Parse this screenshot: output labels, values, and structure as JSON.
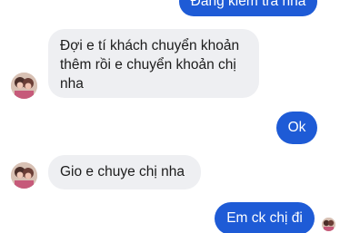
{
  "messages": [
    {
      "sender": "me",
      "text": "Đang kiểm tra nha"
    },
    {
      "sender": "contact",
      "lines": [
        "Đợi e tí khách chuyển khoản",
        "thêm rồi e chuyển khoản chị",
        "nha"
      ]
    },
    {
      "sender": "me",
      "text": "Ok"
    },
    {
      "sender": "contact",
      "text": "Gio e chuye chị nha"
    },
    {
      "sender": "me",
      "text": "Em ck chị đi"
    }
  ],
  "colors": {
    "outgoing_bubble": "#1e5bd6",
    "incoming_bubble": "#eeeff2"
  }
}
